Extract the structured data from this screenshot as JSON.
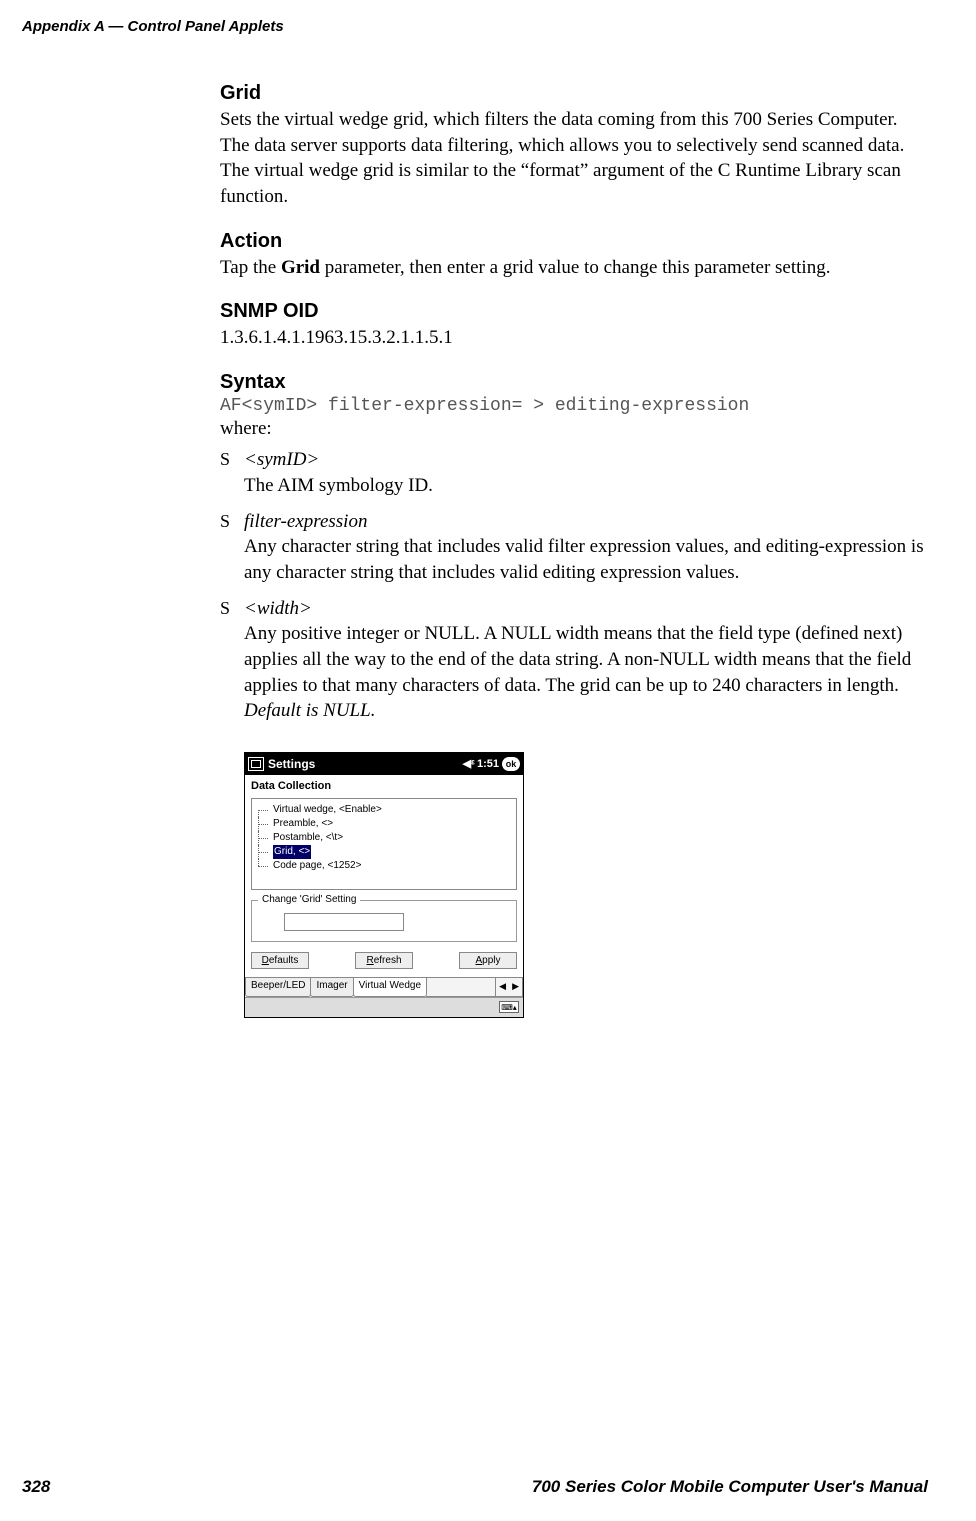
{
  "header": {
    "left": "Appendix  A    —   Control Panel Applets"
  },
  "sections": {
    "grid": {
      "title": "Grid",
      "body": "Sets the virtual wedge grid, which filters the data coming from this 700 Series Computer. The data server supports data filtering, which allows you to selectively send scanned data. The virtual wedge grid is similar to the “format” argument of the C Runtime Library scan function."
    },
    "action": {
      "title": "Action",
      "pre": "Tap the ",
      "bold": "Grid",
      "post": " parameter, then enter a grid value to change this parameter setting."
    },
    "snmp": {
      "title": "SNMP OID",
      "value": "1.3.6.1.4.1.1963.15.3.2.1.1.5.1"
    },
    "syntax": {
      "title": "Syntax",
      "code": "AF<symID> filter-expression= > editing-expression",
      "where": "where:"
    }
  },
  "bullets": {
    "symid": {
      "term": "<symID>",
      "desc": "The AIM symbology ID."
    },
    "filter": {
      "term": "filter-expression",
      "desc": "Any character string that includes valid filter expression values, and editing-expression is any character string that includes valid editing expression values."
    },
    "width": {
      "term": "<width>",
      "desc": "Any positive integer or NULL. A NULL width means that the field type (defined next) applies all the way to the end of the data string. A non-NULL width means that the field applies to that many characters of data. The grid can be up to 240 characters in length. ",
      "default": "Default is NULL."
    }
  },
  "screenshot": {
    "titlebar": {
      "label": "Settings",
      "time": "1:51",
      "ok": "ok"
    },
    "panel_caption": "Data Collection",
    "tree": {
      "item1": "Virtual wedge, <Enable>",
      "item2": "Preamble, <>",
      "item3": "Postamble, <\\t>",
      "item4": "Grid, <>",
      "item5": "Code page, <1252>"
    },
    "fieldset_legend": "Change 'Grid' Setting",
    "buttons": {
      "defaults": "Defaults",
      "refresh": "Refresh",
      "apply": "Apply"
    },
    "tabs": {
      "t1": "Beeper/LED",
      "t2": "Imager",
      "t3": "Virtual Wedge"
    }
  },
  "footer": {
    "page": "328",
    "manual": "700 Series Color Mobile Computer  User's Manual"
  }
}
